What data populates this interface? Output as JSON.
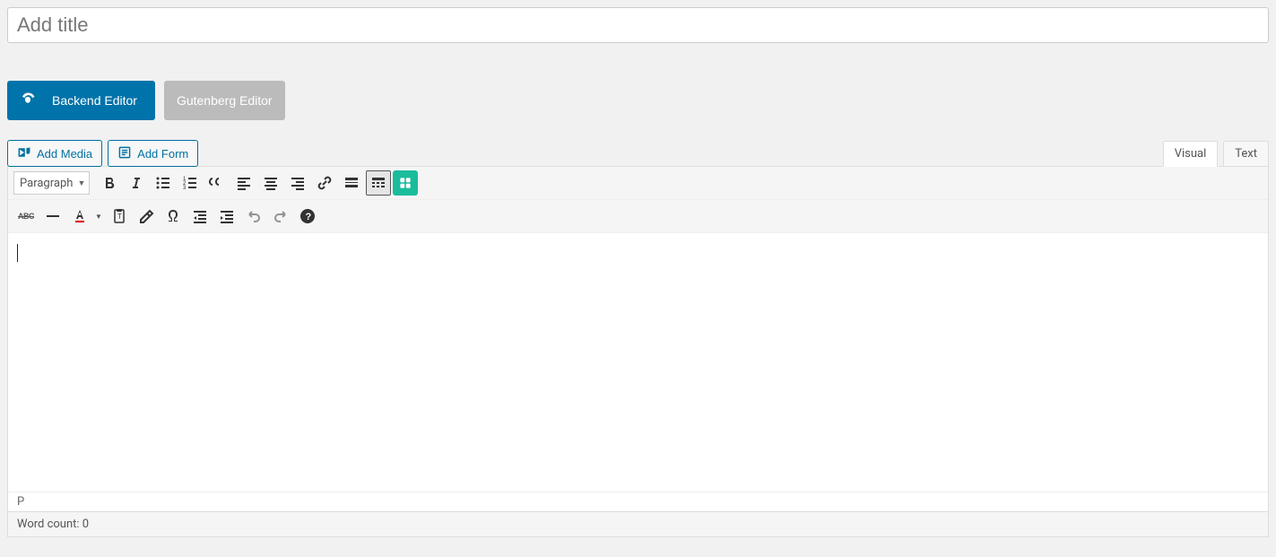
{
  "title": {
    "placeholder": "Add title"
  },
  "buttons": {
    "backend": "Backend Editor",
    "gutenberg": "Gutenberg Editor",
    "add_media": "Add Media",
    "add_form": "Add Form"
  },
  "tabs": {
    "visual": "Visual",
    "text": "Text"
  },
  "toolbar": {
    "format": "Paragraph"
  },
  "footer": {
    "path": "P",
    "wordcount_label": "Word count: ",
    "wordcount_value": "0"
  }
}
